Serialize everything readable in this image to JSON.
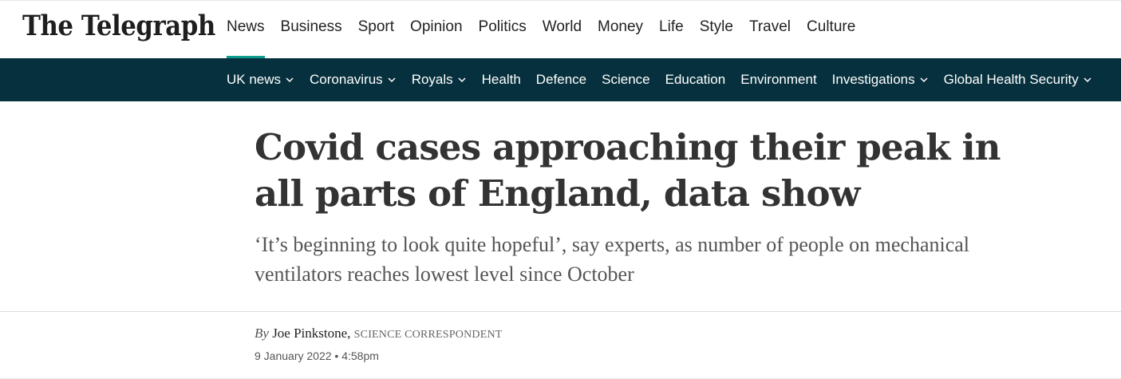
{
  "header": {
    "logo_text": "The Telegraph",
    "primary_nav": [
      {
        "label": "News",
        "active": true
      },
      {
        "label": "Business"
      },
      {
        "label": "Sport"
      },
      {
        "label": "Opinion"
      },
      {
        "label": "Politics"
      },
      {
        "label": "World"
      },
      {
        "label": "Money"
      },
      {
        "label": "Life"
      },
      {
        "label": "Style"
      },
      {
        "label": "Travel"
      },
      {
        "label": "Culture"
      }
    ],
    "accent_color": "#0e9c8f"
  },
  "sub_nav": {
    "background": "#06303d",
    "items": [
      {
        "label": "UK news",
        "dropdown": true
      },
      {
        "label": "Coronavirus",
        "dropdown": true
      },
      {
        "label": "Royals",
        "dropdown": true
      },
      {
        "label": "Health",
        "dropdown": false
      },
      {
        "label": "Defence",
        "dropdown": false
      },
      {
        "label": "Science",
        "dropdown": false
      },
      {
        "label": "Education",
        "dropdown": false
      },
      {
        "label": "Environment",
        "dropdown": false
      },
      {
        "label": "Investigations",
        "dropdown": true
      },
      {
        "label": "Global Health Security",
        "dropdown": true
      }
    ]
  },
  "article": {
    "headline": "Covid cases approaching their peak in all parts of England, data show",
    "standfirst": "‘It’s beginning to look quite hopeful’, say experts, as number of people on mechanical ventilators reaches lowest level since October",
    "byline": {
      "by": "By",
      "author": "Joe Pinkstone,",
      "role": "SCIENCE CORRESPONDENT"
    },
    "date": "9 January 2022 • 4:58pm"
  }
}
